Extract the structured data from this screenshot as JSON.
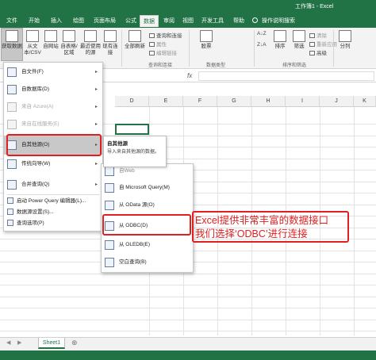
{
  "window": {
    "title": "工作簿1 - Excel"
  },
  "tabs": [
    {
      "label": "文件"
    },
    {
      "label": "开始"
    },
    {
      "label": "插入"
    },
    {
      "label": "绘图"
    },
    {
      "label": "页面布局"
    },
    {
      "label": "公式"
    },
    {
      "label": "数据"
    },
    {
      "label": "审阅"
    },
    {
      "label": "视图"
    },
    {
      "label": "开发工具"
    },
    {
      "label": "帮助"
    }
  ],
  "tell_me": "操作说明搜索",
  "ribbon": {
    "get_data": "获取数据",
    "from_text_csv": "从文本/CSV",
    "from_web": "自网站",
    "from_table": "自表格/区域",
    "recent_sources": "最近使用的源",
    "existing_conn": "现有连接",
    "refresh_all": "全部刷新",
    "queries_conn": "查询和连接",
    "properties": "属性",
    "edit_links": "编辑链接",
    "group_queries": "查询和连接",
    "stocks": "股票",
    "group_types": "数据类型",
    "sort": "排序",
    "filter": "筛选",
    "clear": "清除",
    "reapply": "重新应用",
    "advanced": "高级",
    "group_sort": "排序和筛选",
    "split": "分列"
  },
  "columns": [
    "D",
    "E",
    "F",
    "G",
    "H",
    "I",
    "J",
    "K",
    "L",
    "M"
  ],
  "menu_main": [
    {
      "label": "自文件(F)",
      "arrow": "▸",
      "disabled": false
    },
    {
      "label": "自数据库(D)",
      "arrow": "▸",
      "disabled": false
    },
    {
      "label": "来自 Azure(A)",
      "arrow": "▸",
      "disabled": true
    },
    {
      "label": "来自在线服务(E)",
      "arrow": "▸",
      "disabled": true
    },
    {
      "label": "自其他源(O)",
      "arrow": "▸",
      "disabled": false
    },
    {
      "label": "传统向导(W)",
      "arrow": "▸",
      "disabled": false
    },
    {
      "label": "合并查询(Q)",
      "arrow": "▸",
      "disabled": false
    }
  ],
  "menu_bottom": [
    {
      "label": "启动 Power Query 编辑器(L)..."
    },
    {
      "label": "数据源设置(S)..."
    },
    {
      "label": "查询选项(P)"
    }
  ],
  "tooltip": {
    "title": "自其他源",
    "body": "导入来自其他源的数据。"
  },
  "menu_sub": [
    {
      "label": "自 Microsoft Query(M)"
    },
    {
      "label": "从 OData 源(O)"
    },
    {
      "label": "从 ODBC(D)"
    },
    {
      "label": "从 OLEDB(E)"
    },
    {
      "label": "空白查询(B)"
    }
  ],
  "sub_partial": "自Web",
  "callout": [
    "Excel提供非常丰富的数据接口",
    "我们选择‘ODBC’进行连接"
  ],
  "sheet": {
    "name": "Sheet1",
    "add": "⊕"
  }
}
